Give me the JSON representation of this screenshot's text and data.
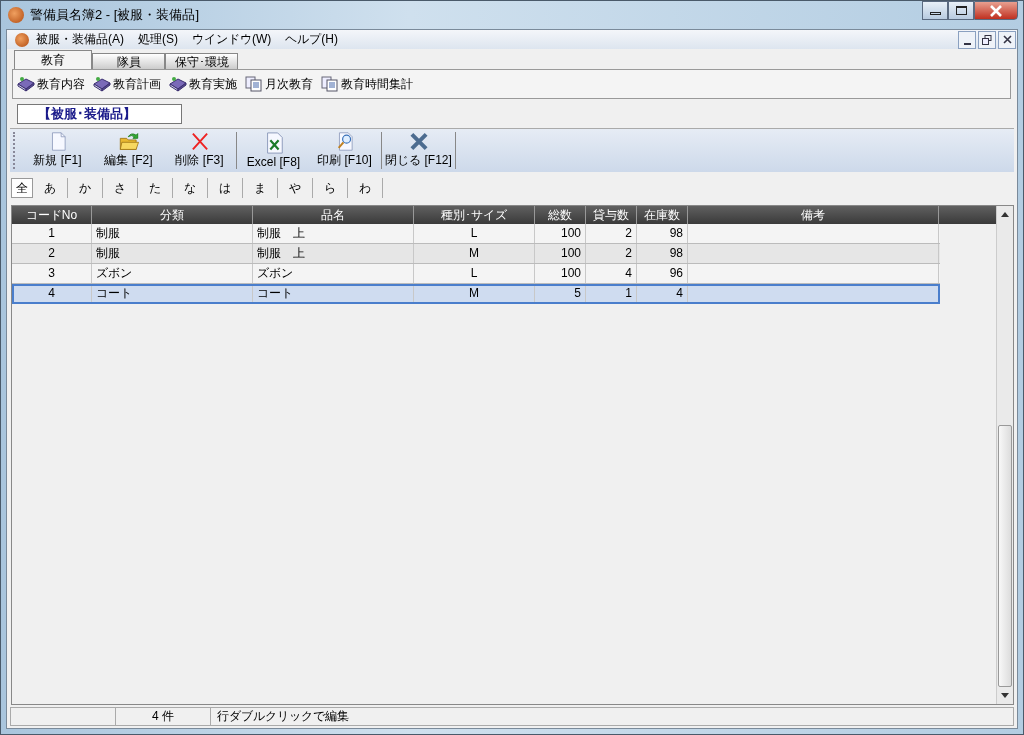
{
  "window": {
    "title": "警備員名簿2 - [被服・装備品]"
  },
  "menu": [
    "被服・装備品(A)",
    "処理(S)",
    "ウインドウ(W)",
    "ヘルプ(H)"
  ],
  "tabs": [
    {
      "label": "教育",
      "selected": true
    },
    {
      "label": "隊員",
      "selected": false
    },
    {
      "label": "保守･環境",
      "selected": false
    }
  ],
  "launcher": [
    {
      "label": "教育内容",
      "kind": "book"
    },
    {
      "label": "教育計画",
      "kind": "book"
    },
    {
      "label": "教育実施",
      "kind": "book"
    },
    {
      "label": "月次教育",
      "kind": "doc"
    },
    {
      "label": "教育時間集計",
      "kind": "doc"
    }
  ],
  "section_label": "【被服･装備品】",
  "toolbar": [
    {
      "label": "新規 [F1]",
      "kind": "new"
    },
    {
      "label": "編集 [F2]",
      "kind": "edit"
    },
    {
      "label": "削除 [F3]",
      "kind": "delete"
    },
    {
      "label": "Excel [F8]",
      "kind": "excel",
      "group_start": true
    },
    {
      "label": "印刷 [F10]",
      "kind": "print"
    },
    {
      "label": "閉じる [F12]",
      "kind": "close",
      "group_start": true
    }
  ],
  "kana": [
    {
      "label": "全",
      "selected": true
    },
    {
      "label": "あ",
      "selected": false
    },
    {
      "label": "か",
      "selected": false
    },
    {
      "label": "さ",
      "selected": false
    },
    {
      "label": "た",
      "selected": false
    },
    {
      "label": "な",
      "selected": false
    },
    {
      "label": "は",
      "selected": false
    },
    {
      "label": "ま",
      "selected": false
    },
    {
      "label": "や",
      "selected": false
    },
    {
      "label": "ら",
      "selected": false
    },
    {
      "label": "わ",
      "selected": false
    }
  ],
  "table": {
    "columns": [
      "コードNo",
      "分類",
      "品名",
      "種別･サイズ",
      "総数",
      "貸与数",
      "在庫数",
      "備考"
    ],
    "rows": [
      {
        "cells": [
          "1",
          "制服",
          "制服　上",
          "L",
          "100",
          "2",
          "98"
        ],
        "selected": false
      },
      {
        "cells": [
          "2",
          "制服",
          "制服　上",
          "M",
          "100",
          "2",
          "98"
        ],
        "selected": false
      },
      {
        "cells": [
          "3",
          "ズボン",
          "ズボン",
          "L",
          "100",
          "4",
          "96"
        ],
        "selected": false
      },
      {
        "cells": [
          "4",
          "コート",
          "コート",
          "M",
          "5",
          "1",
          "4"
        ],
        "selected": true
      }
    ]
  },
  "status_bar": {
    "count": "4 件",
    "hint": "行ダブルクリックで編集"
  }
}
